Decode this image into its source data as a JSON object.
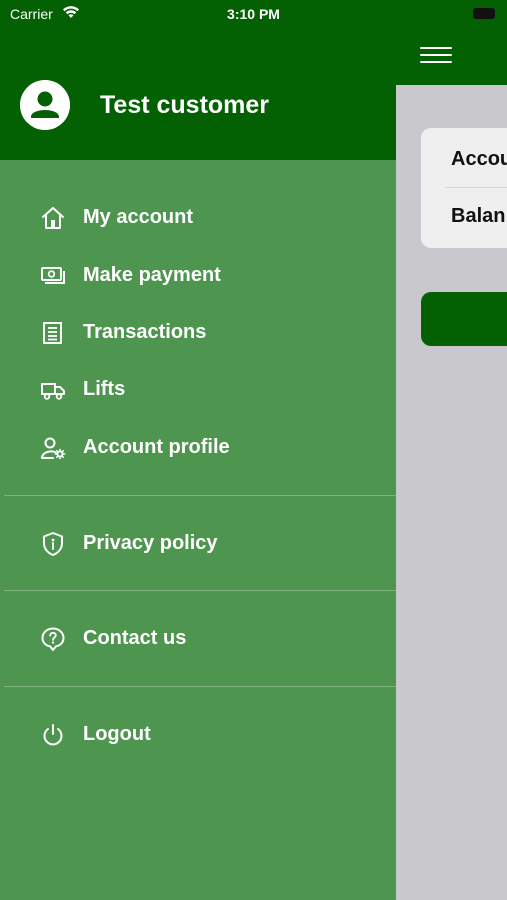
{
  "status_bar": {
    "carrier": "Carrier",
    "time": "3:10 PM"
  },
  "drawer": {
    "user_name": "Test customer",
    "menu": {
      "my_account": "My account",
      "make_payment": "Make payment",
      "transactions": "Transactions",
      "lifts": "Lifts",
      "account_profile": "Account profile",
      "privacy_policy": "Privacy policy",
      "contact_us": "Contact us",
      "logout": "Logout"
    }
  },
  "background": {
    "row1_label": "Accou",
    "row2_label": "Balan"
  },
  "colors": {
    "header_green": "#036103",
    "drawer_green": "#4e9650",
    "divider": "#7fb480",
    "content_bg": "#c9c8cd"
  },
  "icons": {
    "my_account": "home-icon",
    "make_payment": "money-icon",
    "transactions": "receipt-icon",
    "lifts": "truck-icon",
    "account_profile": "user-gear-icon",
    "privacy_policy": "shield-info-icon",
    "contact_us": "help-icon",
    "logout": "power-icon"
  }
}
